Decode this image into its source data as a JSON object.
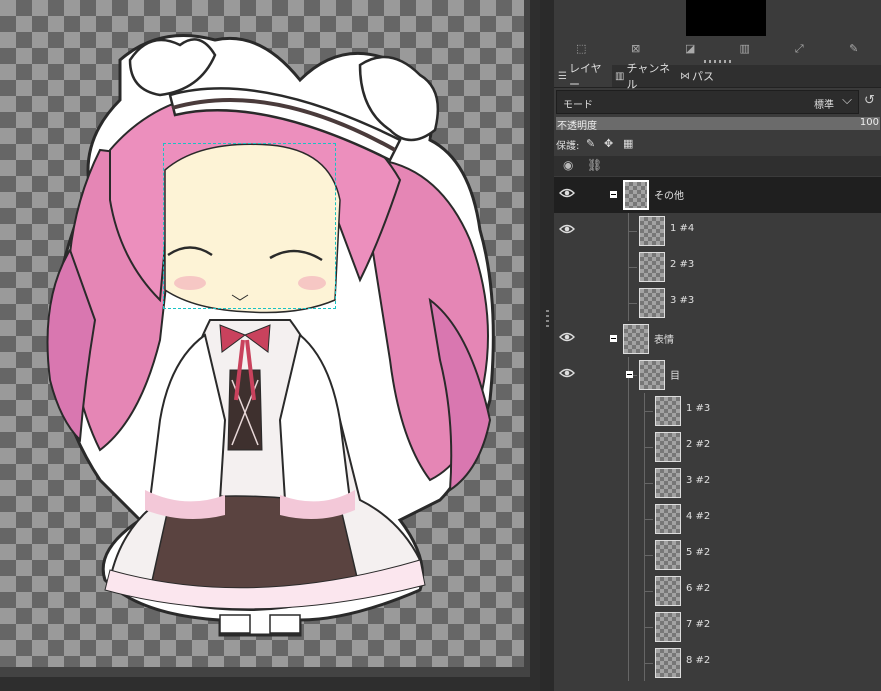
{
  "dock": {
    "tabs": [
      {
        "label": "レイヤー",
        "icon": "layers-icon"
      },
      {
        "label": "チャンネル",
        "icon": "channels-icon"
      },
      {
        "label": "パス",
        "icon": "paths-icon"
      }
    ],
    "mode": {
      "label": "モード",
      "value": "標準"
    },
    "opacity": {
      "label": "不透明度",
      "value": "100"
    },
    "lock": {
      "label": "保護:"
    },
    "layers": [
      {
        "name": "その他",
        "depth": 0,
        "group": true,
        "visible": true,
        "selected": true
      },
      {
        "name": "1 #4",
        "depth": 1,
        "group": false,
        "visible": true,
        "selected": false
      },
      {
        "name": "2 #3",
        "depth": 1,
        "group": false,
        "visible": false,
        "selected": false
      },
      {
        "name": "3 #3",
        "depth": 1,
        "group": false,
        "visible": false,
        "selected": false
      },
      {
        "name": "表情",
        "depth": 0,
        "group": true,
        "visible": true,
        "selected": false
      },
      {
        "name": "目",
        "depth": 1,
        "group": true,
        "visible": true,
        "selected": false
      },
      {
        "name": "1 #3",
        "depth": 2,
        "group": false,
        "visible": false,
        "selected": false
      },
      {
        "name": "2 #2",
        "depth": 2,
        "group": false,
        "visible": false,
        "selected": false
      },
      {
        "name": "3 #2",
        "depth": 2,
        "group": false,
        "visible": false,
        "selected": false
      },
      {
        "name": "4 #2",
        "depth": 2,
        "group": false,
        "visible": false,
        "selected": false
      },
      {
        "name": "5 #2",
        "depth": 2,
        "group": false,
        "visible": false,
        "selected": false
      },
      {
        "name": "6 #2",
        "depth": 2,
        "group": false,
        "visible": false,
        "selected": false
      },
      {
        "name": "7 #2",
        "depth": 2,
        "group": false,
        "visible": false,
        "selected": false
      },
      {
        "name": "8 #2",
        "depth": 2,
        "group": false,
        "visible": false,
        "selected": false
      }
    ]
  }
}
